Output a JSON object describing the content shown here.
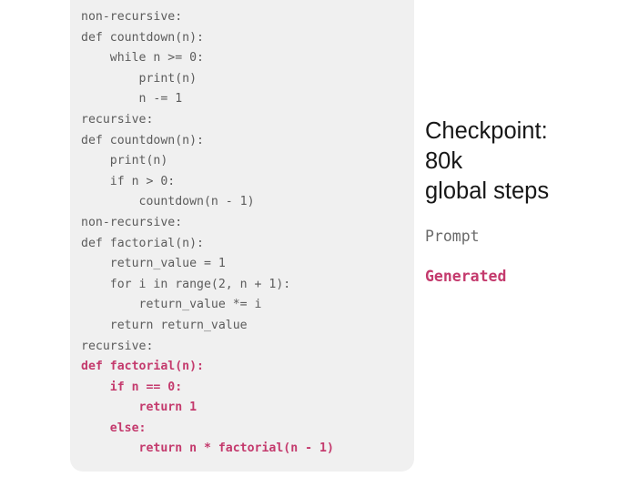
{
  "card": {
    "background": "#f0f0f0",
    "code_lines": [
      {
        "text": "non-recursive:",
        "kind": "prompt"
      },
      {
        "text": "def countdown(n):",
        "kind": "prompt"
      },
      {
        "text": "    while n >= 0:",
        "kind": "prompt"
      },
      {
        "text": "        print(n)",
        "kind": "prompt"
      },
      {
        "text": "        n -= 1",
        "kind": "prompt"
      },
      {
        "text": "recursive:",
        "kind": "prompt"
      },
      {
        "text": "def countdown(n):",
        "kind": "prompt"
      },
      {
        "text": "    print(n)",
        "kind": "prompt"
      },
      {
        "text": "    if n > 0:",
        "kind": "prompt"
      },
      {
        "text": "        countdown(n - 1)",
        "kind": "prompt"
      },
      {
        "text": "non-recursive:",
        "kind": "prompt"
      },
      {
        "text": "def factorial(n):",
        "kind": "prompt"
      },
      {
        "text": "    return_value = 1",
        "kind": "prompt"
      },
      {
        "text": "    for i in range(2, n + 1):",
        "kind": "prompt"
      },
      {
        "text": "        return_value *= i",
        "kind": "prompt"
      },
      {
        "text": "    return return_value",
        "kind": "prompt"
      },
      {
        "text": "recursive:",
        "kind": "prompt"
      },
      {
        "text": "def factorial(n):",
        "kind": "generated"
      },
      {
        "text": "    if n == 0:",
        "kind": "generated"
      },
      {
        "text": "        return 1",
        "kind": "generated"
      },
      {
        "text": "    else:",
        "kind": "generated"
      },
      {
        "text": "        return n * factorial(n - 1)",
        "kind": "generated"
      }
    ]
  },
  "legend": {
    "title": "Checkpoint:\n80k\nglobal steps",
    "prompt_label": "Prompt",
    "generated_label": "Generated",
    "prompt_color": "#6a6a6a",
    "generated_color": "#c43a6d"
  },
  "logo": {
    "name": "sakura-blossom-logo",
    "circle_color": "#6d86c6",
    "petal_color": "#f9d3dc",
    "petal_count": 5
  }
}
